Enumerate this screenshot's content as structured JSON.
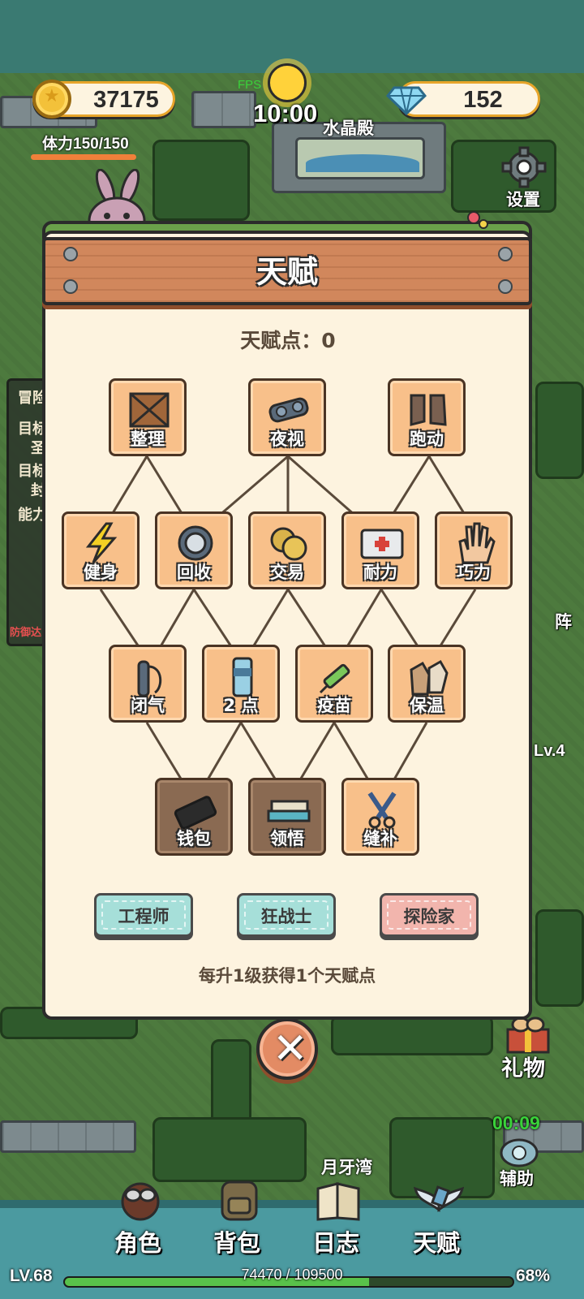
{
  "hud": {
    "coins": "37175",
    "gems": "152",
    "stamina_label": "体力150/150",
    "stamina_fraction": 1.0,
    "fps_label": "FPS",
    "clock": "10:00",
    "location": "水晶殿",
    "settings_label": "设置"
  },
  "side": {
    "gift_label": "礼物",
    "assist_timer": "00:09",
    "assist_label": "辅助",
    "map_label": "月牙湾",
    "partial_right_1": "阵",
    "partial_right_2": "Lv.4",
    "left_partial": [
      "冒险",
      "目标",
      "圣",
      "目标",
      "封",
      "能力",
      "防御达"
    ]
  },
  "dialog": {
    "title": "天赋",
    "points_label": "天赋点：0",
    "rows": [
      [
        {
          "label": "整理",
          "icon": "crate-icon",
          "locked": false
        },
        {
          "label": "夜视",
          "icon": "goggles-icon",
          "locked": false
        },
        {
          "label": "跑动",
          "icon": "boots-icon",
          "locked": false
        }
      ],
      [
        {
          "label": "健身",
          "icon": "lightning-icon",
          "locked": false
        },
        {
          "label": "回收",
          "icon": "gear-icon",
          "locked": false
        },
        {
          "label": "交易",
          "icon": "coins-icon",
          "locked": false
        },
        {
          "label": "耐力",
          "icon": "medkit-icon",
          "locked": false
        },
        {
          "label": "巧力",
          "icon": "hand-icon",
          "locked": false
        }
      ],
      [
        {
          "label": "闭气",
          "icon": "oxygen-tank-icon",
          "locked": false
        },
        {
          "label": "2 点",
          "icon": "bottle-icon",
          "locked": false
        },
        {
          "label": "疫苗",
          "icon": "syringe-icon",
          "locked": false
        },
        {
          "label": "保温",
          "icon": "gloves-icon",
          "locked": false
        }
      ],
      [
        {
          "label": "钱包",
          "icon": "wallet-icon",
          "locked": true
        },
        {
          "label": "领悟",
          "icon": "books-icon",
          "locked": true
        },
        {
          "label": "缝补",
          "icon": "scissors-icon",
          "locked": false
        }
      ]
    ],
    "class_buttons": [
      {
        "label": "工程师",
        "color": "#a6dfd9"
      },
      {
        "label": "狂战士",
        "color": "#a6dfd9"
      },
      {
        "label": "探险家",
        "color": "#f2b5ad"
      }
    ],
    "footer_note": "每升1级获得1个天赋点"
  },
  "nav": {
    "items": [
      {
        "label": "角色",
        "icon": "character-icon"
      },
      {
        "label": "背包",
        "icon": "backpack-icon"
      },
      {
        "label": "日志",
        "icon": "journal-icon"
      },
      {
        "label": "天赋",
        "icon": "talent-wings-icon"
      }
    ]
  },
  "xp": {
    "level": "LV.68",
    "text": "74470 / 109500",
    "percent": "68%",
    "fraction": 0.68
  }
}
